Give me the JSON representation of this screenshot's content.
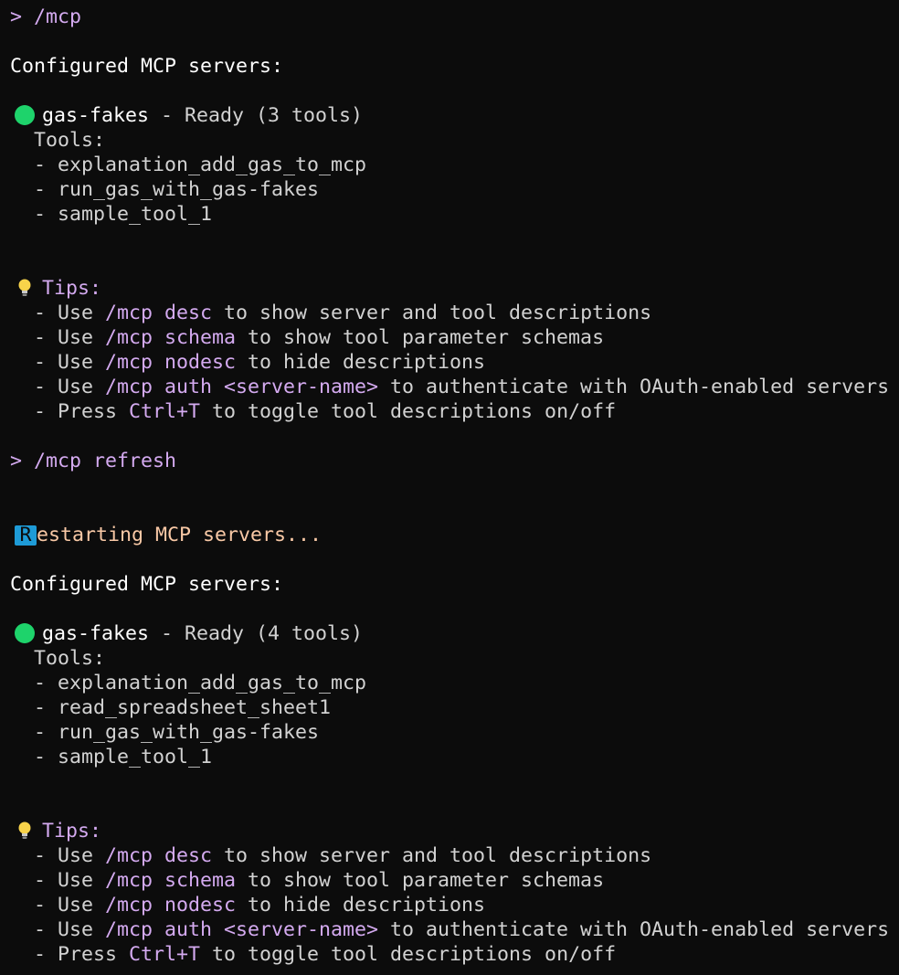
{
  "colors": {
    "background": "#0c0c0c",
    "ready_dot": "#1ed36b",
    "prompt": "#d4aaf0",
    "status_text": "#f9c9a6",
    "spinner_bg": "#1e9bd7"
  },
  "command1": "/mcp",
  "prompt_symbol": ">",
  "block1": {
    "heading": "Configured MCP servers:",
    "server": {
      "name": "gas-fakes",
      "separator": " - ",
      "status": "Ready (3 tools)",
      "status_icon": "green-dot-icon"
    },
    "tools_label": "Tools:",
    "tools": [
      "- explanation_add_gas_to_mcp",
      "- run_gas_with_gas-fakes",
      "- sample_tool_1"
    ]
  },
  "tips1": {
    "icon": "lightbulb-icon",
    "label": "Tips:",
    "items": [
      {
        "pre": "- Use ",
        "cmd": "/mcp desc",
        "post": " to show server and tool descriptions"
      },
      {
        "pre": "- Use ",
        "cmd": "/mcp schema",
        "post": " to show tool parameter schemas"
      },
      {
        "pre": "- Use ",
        "cmd": "/mcp nodesc",
        "post": " to hide descriptions"
      },
      {
        "pre": "- Use ",
        "cmd": "/mcp auth <server-name>",
        "post": " to authenticate with OAuth-enabled servers"
      },
      {
        "pre": "- Press ",
        "cmd": "Ctrl+T",
        "post": " to toggle tool descriptions on/off"
      }
    ]
  },
  "command2": "/mcp refresh",
  "restart": {
    "cursor_char": "R",
    "text": "estarting MCP servers..."
  },
  "block2": {
    "heading": "Configured MCP servers:",
    "server": {
      "name": "gas-fakes",
      "separator": " - ",
      "status": "Ready (4 tools)",
      "status_icon": "green-dot-icon"
    },
    "tools_label": "Tools:",
    "tools": [
      "- explanation_add_gas_to_mcp",
      "- read_spreadsheet_sheet1",
      "- run_gas_with_gas-fakes",
      "- sample_tool_1"
    ]
  },
  "tips2": {
    "icon": "lightbulb-icon",
    "label": "Tips:",
    "items": [
      {
        "pre": "- Use ",
        "cmd": "/mcp desc",
        "post": " to show server and tool descriptions"
      },
      {
        "pre": "- Use ",
        "cmd": "/mcp schema",
        "post": " to show tool parameter schemas"
      },
      {
        "pre": "- Use ",
        "cmd": "/mcp nodesc",
        "post": " to hide descriptions"
      },
      {
        "pre": "- Use ",
        "cmd": "/mcp auth <server-name>",
        "post": " to authenticate with OAuth-enabled servers"
      },
      {
        "pre": "- Press ",
        "cmd": "Ctrl+T",
        "post": " to toggle tool descriptions on/off"
      }
    ]
  }
}
